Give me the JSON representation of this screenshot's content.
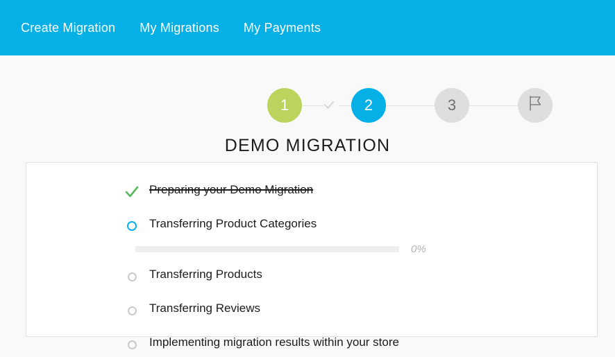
{
  "nav": {
    "items": [
      {
        "label": "Create Migration"
      },
      {
        "label": "My Migrations"
      },
      {
        "label": "My Payments"
      }
    ]
  },
  "stepper": {
    "steps": [
      {
        "label": "1",
        "state": "complete",
        "color": "#bcd45e"
      },
      {
        "label": "2",
        "state": "current",
        "color": "#04b0e6"
      },
      {
        "label": "3",
        "state": "pending",
        "color": "#dedede"
      },
      {
        "label": "",
        "state": "pending",
        "color": "#dedede",
        "icon": "flag-icon"
      }
    ],
    "connector_check_icon": "check-icon"
  },
  "page": {
    "title": "DEMO MIGRATION"
  },
  "tasks": [
    {
      "label": "Preparing your Demo Migration",
      "status": "done",
      "marker": "check-icon"
    },
    {
      "label": "Transferring Product Categories",
      "status": "in-progress",
      "marker": "circle-icon",
      "progress": {
        "percent": 0,
        "percent_label": "0%"
      }
    },
    {
      "label": "Transferring Products",
      "status": "pending",
      "marker": "circle-icon"
    },
    {
      "label": "Transferring Reviews",
      "status": "pending",
      "marker": "circle-icon"
    },
    {
      "label": "Implementing migration results within your store",
      "status": "pending",
      "marker": "circle-icon"
    }
  ],
  "colors": {
    "brand": "#04b0e6",
    "complete": "#bcd45e",
    "check_green": "#5cb85c",
    "pending_gray": "#dedede",
    "page_bg": "#f9f9f9"
  }
}
